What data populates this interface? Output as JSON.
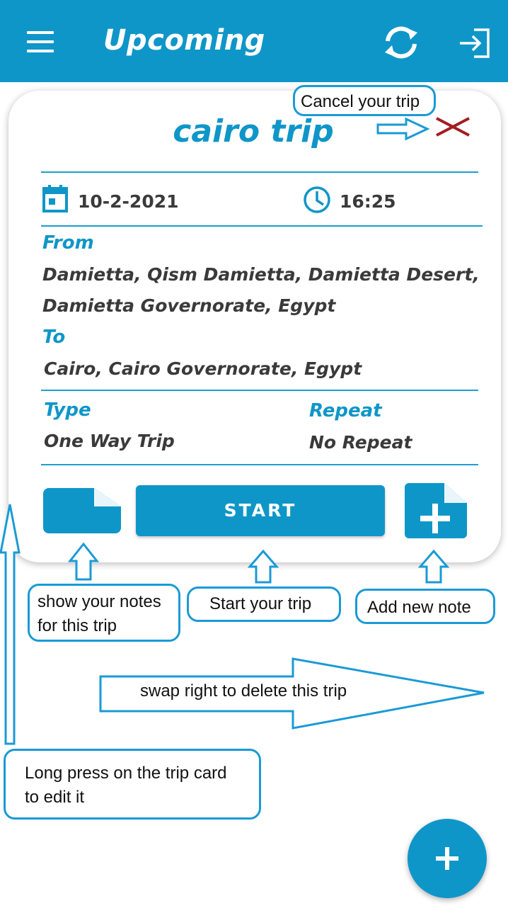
{
  "appbar": {
    "title": "Upcoming",
    "icons": [
      "menu-icon",
      "refresh-icon",
      "logout-icon"
    ],
    "color": "#0f96c8"
  },
  "trip": {
    "title": "cairo trip",
    "date": "10-2-2021",
    "time": "16:25",
    "from_label": "From",
    "from_line1": "Damietta, Qism Damietta, Damietta Desert,",
    "from_line2": "Damietta Governorate, Egypt",
    "to_label": "To",
    "to_value": "Cairo, Cairo Governorate, Egypt",
    "type_label": "Type",
    "type_value": "One Way Trip",
    "repeat_label": "Repeat",
    "repeat_value": "No Repeat",
    "start_label": "START",
    "cancel_color": "#a31c22"
  },
  "annotations": {
    "cancel": "Cancel your trip",
    "notes_line1": "show your notes",
    "notes_line2": "for this trip",
    "start": "Start your trip",
    "add_note": "Add new note",
    "swap": "swap right to delete this trip",
    "edit_line1": "Long press on the trip card",
    "edit_line2": "to edit it"
  }
}
